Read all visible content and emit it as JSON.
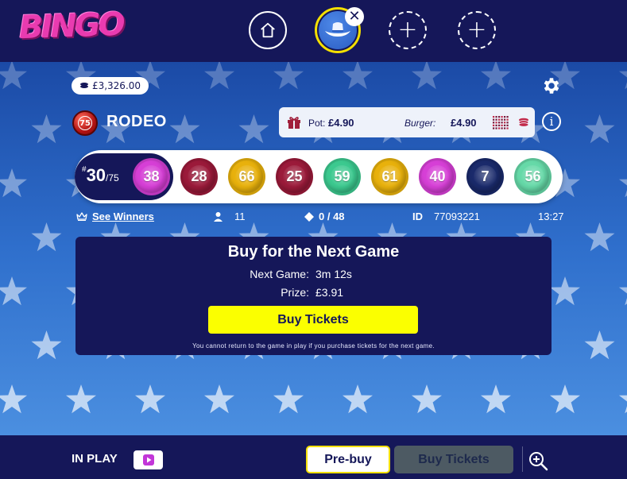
{
  "header": {
    "logo_text": "BINGO",
    "nav": {
      "home_icon": "home-icon",
      "room_icon": "cowboy-hat-icon",
      "close_glyph": "✕",
      "add_glyph": "+"
    }
  },
  "account": {
    "balance": "£3,326.00",
    "settings_icon": "gear-icon"
  },
  "room": {
    "ball_number": "75",
    "name": "RODEO",
    "pot_label": "Pot:",
    "pot_value": "£4.90",
    "burger_label": "Burger:",
    "burger_value": "£4.90",
    "info_glyph": "i"
  },
  "draw": {
    "hash": "#",
    "count": "30",
    "total": "/75",
    "balls": [
      {
        "number": "38",
        "color": "#d63fd6"
      },
      {
        "number": "28",
        "color": "#9b1a3a"
      },
      {
        "number": "66",
        "color": "#e8b10c"
      },
      {
        "number": "25",
        "color": "#9b1a3a"
      },
      {
        "number": "59",
        "color": "#3cc98f"
      },
      {
        "number": "61",
        "color": "#e8b10c"
      },
      {
        "number": "40",
        "color": "#d63fd6"
      },
      {
        "number": "7",
        "color": "#1a2a6b"
      },
      {
        "number": "56",
        "color": "#66d9a8"
      }
    ]
  },
  "game_info": {
    "see_winners": "See Winners",
    "players": "11",
    "tickets": "0 / 48",
    "id_label": "ID",
    "id_value": "77093221",
    "time": "13:27"
  },
  "buy_panel": {
    "title": "Buy for the Next Game",
    "next_game_label": "Next Game:",
    "next_game_value": "3m 12s",
    "prize_label": "Prize:",
    "prize_value": "£3.91",
    "button": "Buy Tickets",
    "note": "You cannot return to the game in play if you purchase tickets for the next game."
  },
  "footer": {
    "in_play": "IN PLAY",
    "prebuy": "Pre-buy",
    "buy_tickets": "Buy Tickets"
  },
  "colors": {
    "navy": "#151759",
    "accent_yellow": "#fbff00",
    "logo_pink": "#e93bb0"
  }
}
